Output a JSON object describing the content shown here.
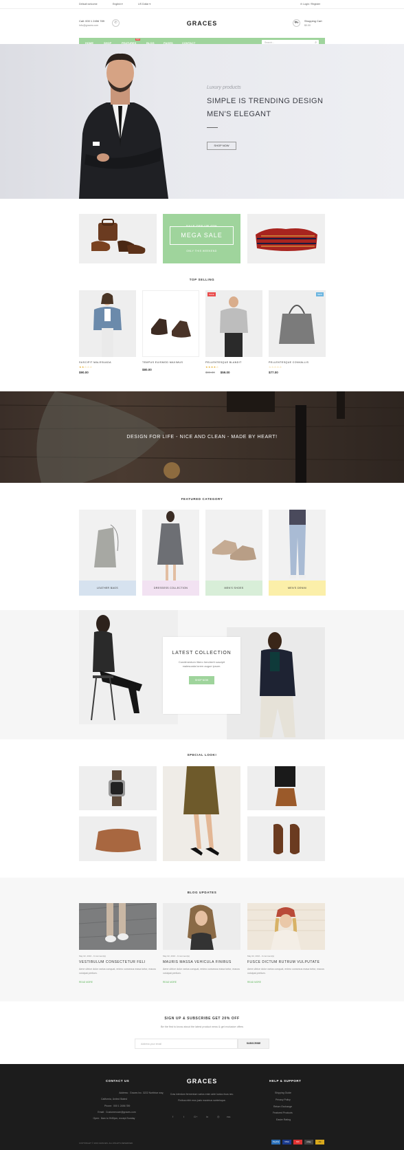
{
  "topbar": {
    "welcome": "Default welcome",
    "lang": "English",
    "currency": "US Dollar",
    "login": "Login / Register"
  },
  "header": {
    "phone": "Call: 000 1 2456 789",
    "email": "Info@graces.com",
    "logo": "GRACES",
    "cart_label": "Shopping Cart",
    "cart_total": "$0.00"
  },
  "nav": {
    "items": [
      "HOME",
      "SHOP",
      "FEATURES",
      "BLOG",
      "PAGES",
      "CONTACT"
    ],
    "hot": "HOT",
    "search_placeholder": "Search..."
  },
  "hero": {
    "subtitle": "Luxury products",
    "title1": "SIMPLE IS TRENDING DESIGN",
    "title2": "MEN'S ELEGANT",
    "button": "SHOP NOW"
  },
  "promo": {
    "top": "SALE OFF UP 40%",
    "title": "MEGA SALE",
    "bottom": "ONLY THIS WEEKEND"
  },
  "top_selling": {
    "title": "TOP SELLING",
    "products": [
      {
        "name": "SUSCIPIT MALESUADA",
        "stars": "★★☆☆☆",
        "price": "$90.00",
        "old": ""
      },
      {
        "name": "TEMPUS EUISMOD MAXIMUS",
        "stars": "",
        "price": "$80.00",
        "old": ""
      },
      {
        "name": "PELLENTESQUE BLANDIT",
        "stars": "★★★★☆",
        "price": "$59.00",
        "old": "$90.00",
        "tag": "SALE"
      },
      {
        "name": "PELLENTESQUE CONVALLIS",
        "stars": "☆☆☆☆☆",
        "price": "$77.00",
        "old": "",
        "tag": "NEW"
      }
    ]
  },
  "banner": {
    "text": "DESIGN FOR LIFE - NICE AND CLEAN - MADE BY HEART!"
  },
  "featured": {
    "title": "FEATURED CATEGORY",
    "cats": [
      "LEATHER BAGS",
      "DRESSESS COLLECTION",
      "MEN'S SHOES",
      "MEN'S DENIM"
    ]
  },
  "latest": {
    "title": "LATEST COLLECTION",
    "desc": "Condimentum libero hendrerit suscipit malesuada lorem augue ipsum.",
    "button": "SHOP NOW"
  },
  "special": {
    "title": "SPECIAL LOOK!"
  },
  "blog": {
    "title": "BLOG UPDATES",
    "posts": [
      {
        "meta": "May 02, 2016 - 0 comment(s)",
        "title": "VESTIBULUM CONSECTETUR FELI",
        "excerpt": "Aene ultrice dolor varius conquat, enimo consecus masa tortor, macus volutpat pretium.",
        "more": "READ MORE"
      },
      {
        "meta": "May 02, 2016 - 0 comment(s)",
        "title": "MAURIS MASSA VEHICULA FINIBUS",
        "excerpt": "Aene ultrice dolor varius conquat, enimo consecus masa tortor, macus volutpat pretium.",
        "more": "READ MORE"
      },
      {
        "meta": "May 02, 2016 - 0 comment(s)",
        "title": "FUSCE DICTUM RUTRUM VULPUTATE",
        "excerpt": "Aene ultrice dolor varius conquat, enimo consecus masa tortor, macus volutpat pretium.",
        "more": "READ MORE"
      }
    ]
  },
  "subscribe": {
    "title": "SIGN UP & SUBSCRIBE GET 20% OFF",
    "desc": "Be the first to know about the latest product news & get exclusive offers",
    "placeholder": "Address your email",
    "button": "SUBSCRIBE"
  },
  "footer": {
    "contact_title": "CONTACT US",
    "address_l": "Address:",
    "address": "Graces Inc. 3222 Northbar way,",
    "address2": "California, United Stated",
    "phone_l": "Phone:",
    "phone": "000 1 2456 789",
    "email_l": "Email:",
    "email": "Customercare@graces.com",
    "open_l": "Open:",
    "open": "8am to 9h30pm, except Sunday",
    "logo": "GRACES",
    "about1": "Cras interdum fermentum varius enim ante luctus risus nec.",
    "about2": "Finibus nibh eros justo maximus scelerisque.",
    "help_title": "HELP & SUPPORT",
    "help": [
      "Shipping Guide",
      "Privacy Policy",
      "Return Exchange",
      "Featured Products",
      "Easier Rating"
    ],
    "social": [
      "f",
      "t",
      "G+",
      "in",
      "◎",
      "rss"
    ],
    "copyright": "COPYRIGHT © 2016 GRACES. ALL RIGHTS RESERVED.",
    "payments": [
      "PayPal",
      "VISA",
      "MC",
      "ebay",
      "AE"
    ]
  }
}
